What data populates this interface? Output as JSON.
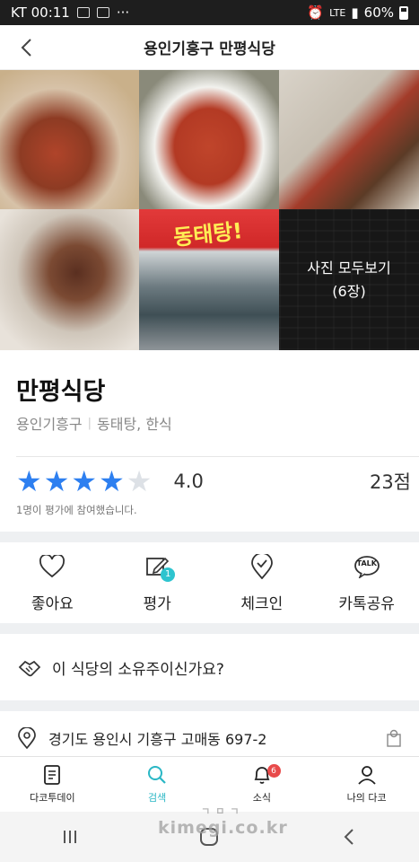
{
  "statusbar": {
    "carrier_time": "KT 00:11",
    "dots": "···",
    "network": "LTE",
    "battery": "60%"
  },
  "header": {
    "title": "용인기흥구 만평식당"
  },
  "photos": {
    "sign_text": "동태탕!",
    "more_label": "사진 모두보기",
    "more_count": "(6장)"
  },
  "restaurant": {
    "name": "만평식당",
    "region": "용인기흥구",
    "category": "동태탕, 한식",
    "rating": 4.0,
    "rating_text": "4.0",
    "points": "23점",
    "votes_text": "1명이 평가에 참여했습니다."
  },
  "actions": [
    {
      "label": "좋아요",
      "icon": "heart-icon"
    },
    {
      "label": "평가",
      "icon": "edit-icon",
      "badge": "1"
    },
    {
      "label": "체크인",
      "icon": "checkin-icon"
    },
    {
      "label": "카톡공유",
      "icon": "talk-icon",
      "icon_text": "TALK"
    }
  ],
  "owner": {
    "text": "이 식당의 소유주이신가요?"
  },
  "address": {
    "text": "경기도 용인시 기흥구 고매동 697-2"
  },
  "tabbar": [
    {
      "label": "다코투데이",
      "icon": "document-icon"
    },
    {
      "label": "검색",
      "icon": "search-icon",
      "active": true
    },
    {
      "label": "소식",
      "icon": "bell-icon",
      "badge": "6"
    },
    {
      "label": "나의 다코",
      "icon": "person-icon"
    }
  ],
  "watermark": {
    "top": "ㄱㅁㄱ",
    "bottom": "kimegi.co.kr"
  },
  "colors": {
    "accent": "#2d7ff0",
    "active_tab": "#2ab7c5",
    "badge_red": "#e84a4a",
    "badge_teal": "#2ec4cf"
  }
}
